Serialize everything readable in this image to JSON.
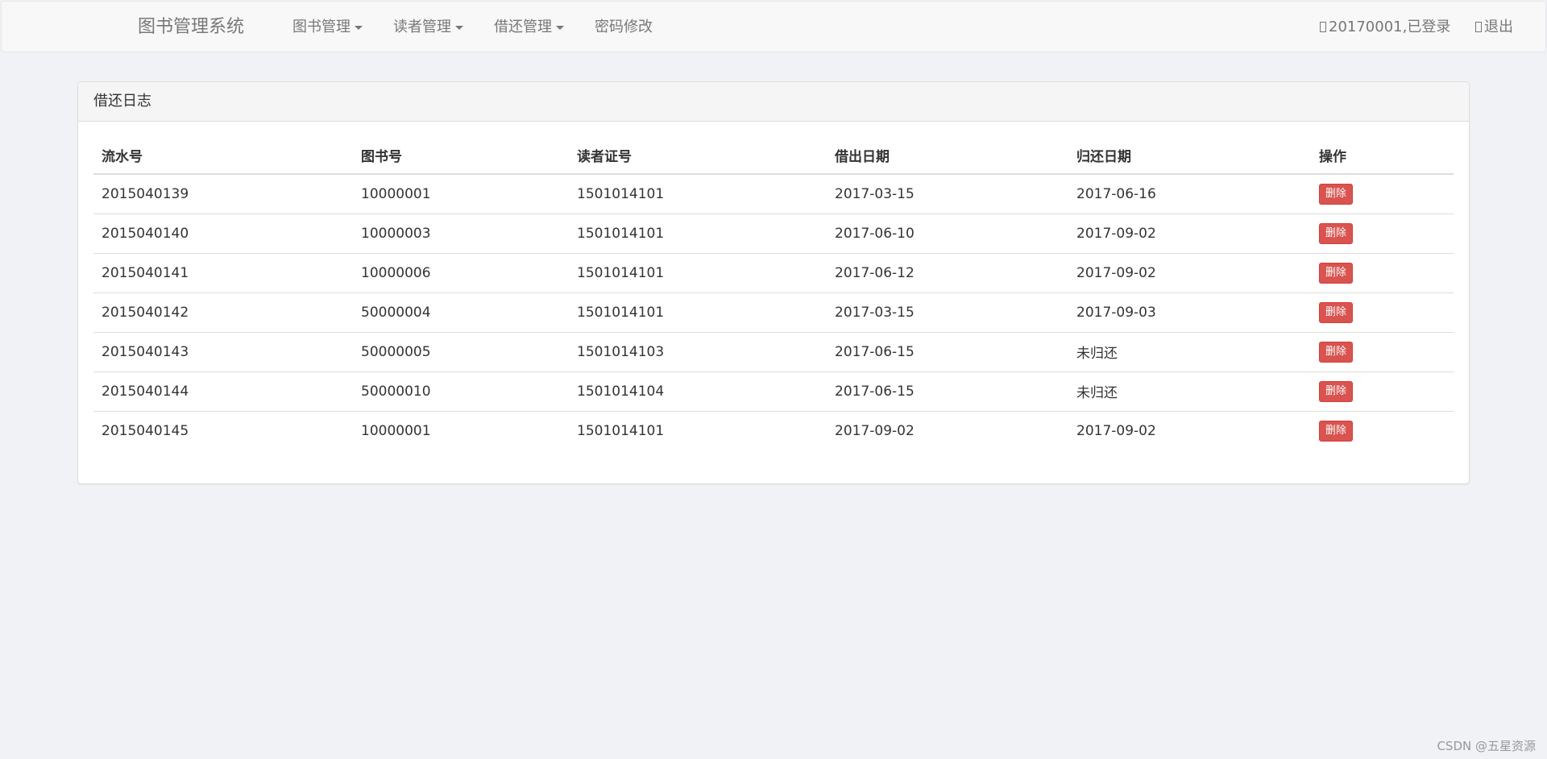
{
  "navbar": {
    "brand": "图书管理系统",
    "menus": [
      {
        "label": "图书管理",
        "has_dropdown": true
      },
      {
        "label": "读者管理",
        "has_dropdown": true
      },
      {
        "label": "借还管理",
        "has_dropdown": true
      },
      {
        "label": "密码修改",
        "has_dropdown": false
      }
    ],
    "user_status": "20170001,已登录",
    "logout_label": "退出"
  },
  "panel": {
    "title": "借还日志",
    "columns": [
      "流水号",
      "图书号",
      "读者证号",
      "借出日期",
      "归还日期",
      "操作"
    ],
    "rows": [
      {
        "serial": "2015040139",
        "book_id": "10000001",
        "reader_id": "1501014101",
        "lend_date": "2017-03-15",
        "return_date": "2017-06-16",
        "action": "删除"
      },
      {
        "serial": "2015040140",
        "book_id": "10000003",
        "reader_id": "1501014101",
        "lend_date": "2017-06-10",
        "return_date": "2017-09-02",
        "action": "删除"
      },
      {
        "serial": "2015040141",
        "book_id": "10000006",
        "reader_id": "1501014101",
        "lend_date": "2017-06-12",
        "return_date": "2017-09-02",
        "action": "删除"
      },
      {
        "serial": "2015040142",
        "book_id": "50000004",
        "reader_id": "1501014101",
        "lend_date": "2017-03-15",
        "return_date": "2017-09-03",
        "action": "删除"
      },
      {
        "serial": "2015040143",
        "book_id": "50000005",
        "reader_id": "1501014103",
        "lend_date": "2017-06-15",
        "return_date": "未归还",
        "action": "删除"
      },
      {
        "serial": "2015040144",
        "book_id": "50000010",
        "reader_id": "1501014104",
        "lend_date": "2017-06-15",
        "return_date": "未归还",
        "action": "删除"
      },
      {
        "serial": "2015040145",
        "book_id": "10000001",
        "reader_id": "1501014101",
        "lend_date": "2017-09-02",
        "return_date": "2017-09-02",
        "action": "删除"
      }
    ]
  },
  "watermark": "CSDN @五星资源",
  "colors": {
    "danger": "#d9534f",
    "navbar_bg": "#f8f8f8",
    "page_bg": "#f0f2f5",
    "nav_text": "#777777"
  },
  "icons": {
    "user": "user-icon",
    "logout": "logout-icon"
  }
}
